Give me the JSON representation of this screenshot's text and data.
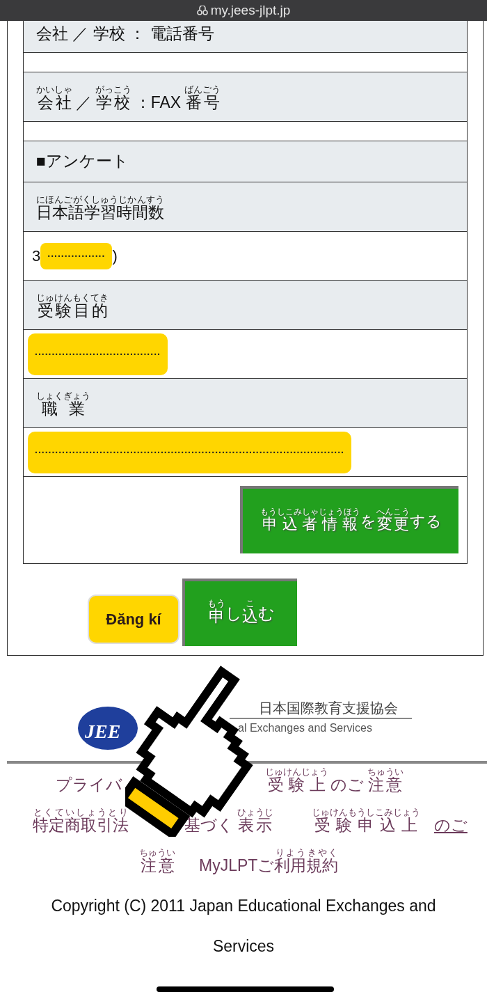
{
  "url_bar": {
    "url": "my.jees-jlpt.jp"
  },
  "form_rows": [
    {
      "kind": "label",
      "segments": [
        {
          "text": "会社 ／ 学校 ： 電話番号"
        }
      ]
    },
    {
      "kind": "value"
    },
    {
      "kind": "label",
      "segments": [
        {
          "text": "会社",
          "ruby": "かいしゃ"
        },
        {
          "text": " ／ "
        },
        {
          "text": "学校",
          "ruby": "がっこう"
        },
        {
          "text": " ：FAX "
        },
        {
          "text": "番号",
          "ruby": "ばんごう"
        }
      ]
    },
    {
      "kind": "value"
    },
    {
      "kind": "section",
      "segments": [
        {
          "text": "■アンケート"
        }
      ]
    },
    {
      "kind": "label",
      "segments": [
        {
          "text": "日本語学習時間数",
          "ruby": "にほんごがくしゅうじかんすう"
        }
      ]
    },
    {
      "kind": "value",
      "text": "3",
      "redaction": ".................",
      "tail": ")"
    },
    {
      "kind": "label",
      "segments": [
        {
          "text": "受験目的",
          "ruby": "じゅけんもくてき"
        }
      ]
    },
    {
      "kind": "value",
      "redaction": "....................................."
    },
    {
      "kind": "label",
      "segments": [
        {
          "text": "職業",
          "ruby": "しょくぎょう"
        }
      ]
    },
    {
      "kind": "value",
      "redaction": "..........................................................................................."
    }
  ],
  "change_button": {
    "segments": [
      {
        "text": "申込者情報",
        "ruby": "もうしこみしゃじょうほう"
      },
      {
        "text": " を"
      },
      {
        "text": "変更",
        "ruby": "へんこう"
      },
      {
        "text": "する"
      }
    ]
  },
  "sticker": {
    "label": "Đăng kí"
  },
  "submit_button": {
    "segments": [
      {
        "text": "申",
        "ruby": "もう"
      },
      {
        "text": "し"
      },
      {
        "text": "込",
        "ruby": "こ"
      },
      {
        "text": "む"
      }
    ]
  },
  "footer": {
    "logo_text": "JEE",
    "org_name": "日本国際教育支援協会",
    "org_name_en": "al Exchanges and Services",
    "links": [
      [
        {
          "segments": [
            {
              "text": "プライバ"
            }
          ]
        },
        {
          "segments": [
            {
              "text": "受験上",
              "ruby": "じゅけんじょう"
            },
            {
              "text": " のご "
            },
            {
              "text": "注意",
              "ruby": "ちゅうい"
            }
          ]
        }
      ],
      [
        {
          "segments": [
            {
              "text": "特定商取引法",
              "ruby": "とくていしょうとり"
            }
          ]
        },
        {
          "segments": [
            {
              "text": "基づく "
            },
            {
              "text": "表示",
              "ruby": "ひょうじ"
            }
          ]
        },
        {
          "segments": [
            {
              "text": "受験申込上",
              "ruby": "じゅけんもうしこみじょう"
            }
          ]
        },
        {
          "underlined": true,
          "segments": [
            {
              "text": "のご"
            }
          ]
        }
      ],
      [
        {
          "segments": [
            {
              "text": "注意",
              "ruby": "ちゅうい"
            }
          ]
        },
        {
          "segments": [
            {
              "text": "MyJLPTご"
            },
            {
              "text": "利用規約",
              "ruby": "りようきやく"
            }
          ]
        }
      ]
    ],
    "copyright": "Copyright (C) 2011 Japan Educational Exchanges and Services"
  }
}
